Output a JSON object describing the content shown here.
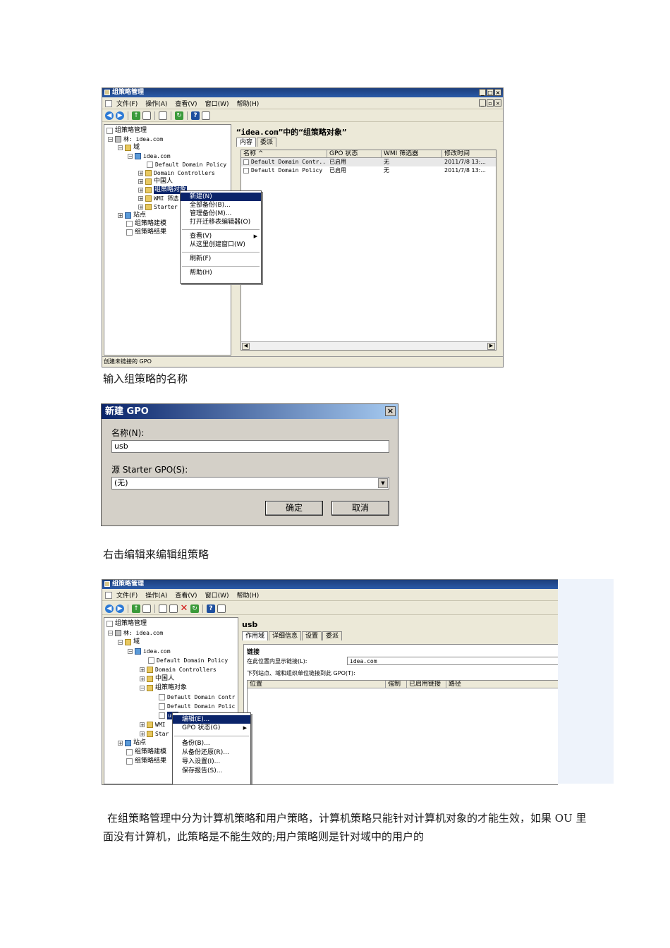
{
  "gpm1": {
    "title": "组策略管理",
    "menu": [
      "文件(F)",
      "操作(A)",
      "查看(V)",
      "窗口(W)",
      "帮助(H)"
    ],
    "tree": {
      "root": "组策略管理",
      "forest": "林: idea.com",
      "domains": "域",
      "domain": "idea.com",
      "ddp": "Default Domain Policy",
      "dc": "Domain Controllers",
      "ou": "中国人",
      "gpo": "组策略对象",
      "wmi": "WMI 筛选",
      "starter": "Starter",
      "sites": "站点",
      "modeling": "组策略建模",
      "results": "组策略结果"
    },
    "context_menu": [
      "新建(N)",
      "全部备份(B)...",
      "管理备份(M)...",
      "打开迁移表编辑器(O)",
      "查看(V)",
      "从这里创建窗口(W)",
      "刷新(F)",
      "帮助(H)"
    ],
    "right_title": "“idea.com”中的“组策略对象”",
    "tabs": [
      "内容",
      "委派"
    ],
    "columns": [
      "名称 ^",
      "GPO 状态",
      "WMI 筛选器",
      "修改时间"
    ],
    "rows": [
      [
        "Default Domain Contr...",
        "已启用",
        "无",
        "2011/7/8 13:..."
      ],
      [
        "Default Domain Policy",
        "已启用",
        "无",
        "2011/7/8 13:..."
      ]
    ],
    "status": "创建未链接的 GPO"
  },
  "caption1": "输入组策略的名称",
  "dialog": {
    "title": "新建 GPO",
    "name_label": "名称(N):",
    "name_value": "usb",
    "source_label": "源 Starter GPO(S):",
    "source_value": "(无)",
    "ok": "确定",
    "cancel": "取消"
  },
  "caption2": "右击编辑来编辑组策略",
  "gpm2": {
    "title": "组策略管理",
    "menu": [
      "文件(F)",
      "操作(A)",
      "查看(V)",
      "窗口(W)",
      "帮助(H)"
    ],
    "tree": {
      "root": "组策略管理",
      "forest": "林: idea.com",
      "domains": "域",
      "domain": "idea.com",
      "ddp": "Default Domain Policy",
      "dc": "Domain Controllers",
      "ou": "中国人",
      "gpo": "组策略对象",
      "gpo1": "Default Domain Contr",
      "gpo2": "Default Domain Polic",
      "usb": "usb",
      "wmi": "WMI",
      "starter": "Star",
      "sites": "站点",
      "modeling": "组策略建模",
      "results": "组策略结果"
    },
    "context_menu": [
      "编辑(E)...",
      "GPO 状态(G)",
      "备份(B)...",
      "从备份还原(R)...",
      "导入设置(I)...",
      "保存报告(S)..."
    ],
    "right_title": "usb",
    "tabs": [
      "作用域",
      "详细信息",
      "设置",
      "委派"
    ],
    "links_label": "链接",
    "links_in_label": "在此位置内显示链接(L):",
    "links_in_value": "idea.com",
    "links_desc": "下列站点、域和组织单位链接到此 GPO(T):",
    "columns": [
      "位置",
      "强制",
      "已启用链接",
      "路径"
    ]
  },
  "paragraph": "在组策略管理中分为计算机策略和用户策略，计算机策略只能针对计算机对象的才能生效，如果 OU 里面没有计算机，此策略是不能生效的;用户策略则是针对域中的用户的"
}
